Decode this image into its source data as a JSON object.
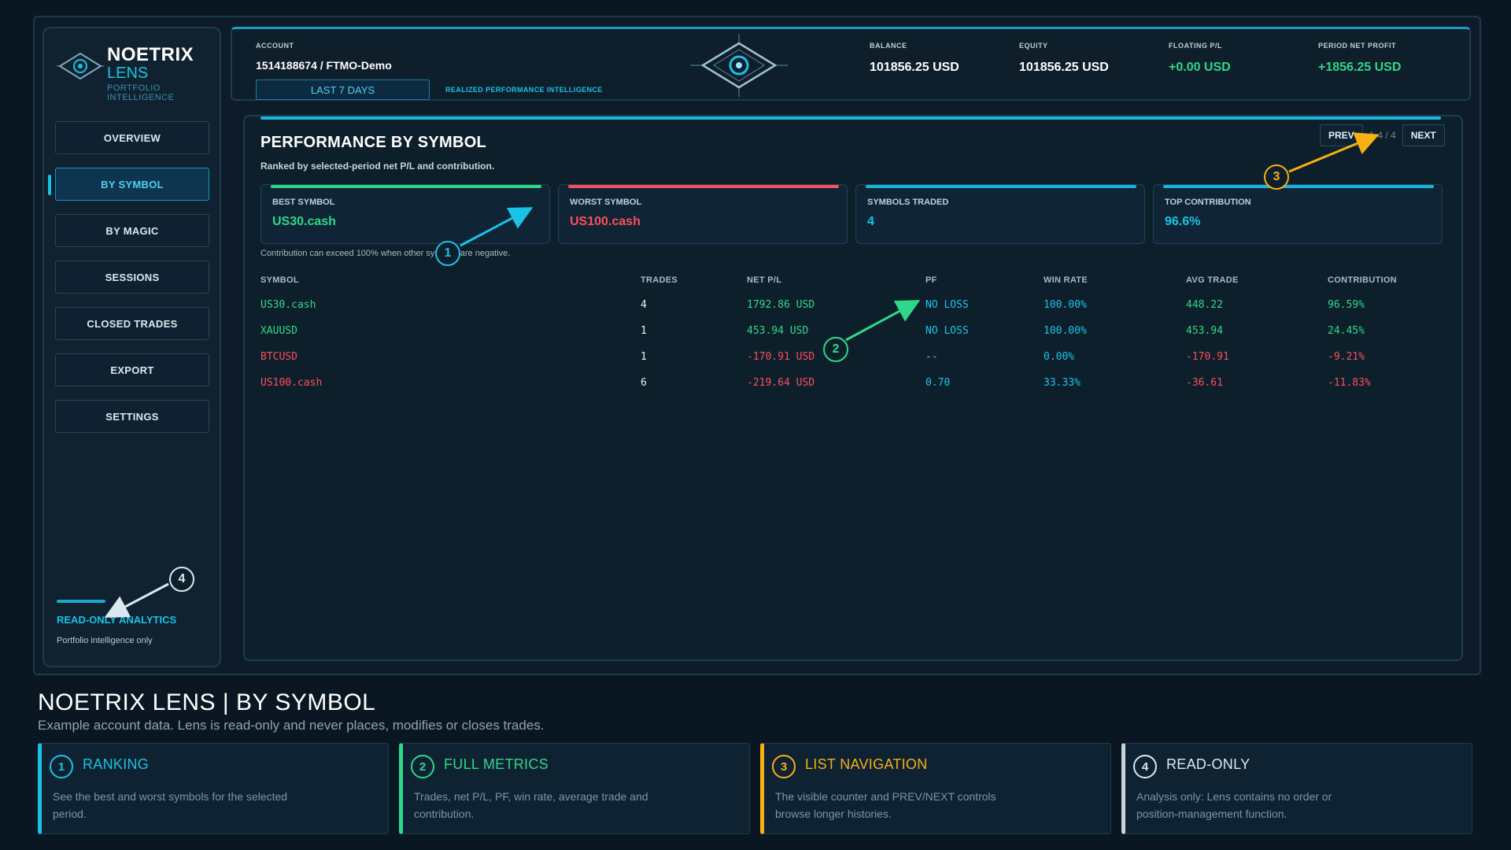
{
  "app": {
    "title": "NOETRIX",
    "subtitle": "LENS",
    "tagline": "PORTFOLIO INTELLIGENCE"
  },
  "nav": {
    "items": [
      "OVERVIEW",
      "BY SYMBOL",
      "BY MAGIC",
      "SESSIONS",
      "CLOSED TRADES",
      "EXPORT",
      "SETTINGS"
    ],
    "active": "BY SYMBOL"
  },
  "sidebar_footer": {
    "title": "READ-ONLY ANALYTICS",
    "subtitle": "Portfolio intelligence only"
  },
  "topbar": {
    "account_label": "ACCOUNT",
    "account_value": "1514188674 / FTMO-Demo",
    "period_button": "LAST 7 DAYS",
    "realized_tag": "REALIZED PERFORMANCE INTELLIGENCE",
    "balance_label": "BALANCE",
    "balance_value": "101856.25 USD",
    "equity_label": "EQUITY",
    "equity_value": "101856.25 USD",
    "floating_label": "FLOATING P/L",
    "floating_value": "+0.00 USD",
    "period_label": "PERIOD NET PROFIT",
    "period_value": "+1856.25 USD"
  },
  "main": {
    "title": "PERFORMANCE BY SYMBOL",
    "subtitle": "Ranked by selected-period net P/L and contribution.",
    "pager": {
      "prev": "PREV",
      "count": "1-4 / 4",
      "next": "NEXT"
    },
    "cards": [
      {
        "label": "BEST SYMBOL",
        "value": "US30.cash",
        "color": "#2ed888"
      },
      {
        "label": "WORST SYMBOL",
        "value": "US100.cash",
        "color": "#ff4d5a"
      },
      {
        "label": "SYMBOLS TRADED",
        "value": "4",
        "color": "#19c3e6"
      },
      {
        "label": "TOP CONTRIBUTION",
        "value": "96.6%",
        "color": "#19c3e6"
      }
    ],
    "note": "Contribution can exceed 100% when other symbols are negative.",
    "table": {
      "headers": [
        "SYMBOL",
        "TRADES",
        "NET P/L",
        "PF",
        "WIN RATE",
        "AVG TRADE",
        "CONTRIBUTION"
      ],
      "rows": [
        {
          "symbol": "US30.cash",
          "trades": "4",
          "net": "1792.86 USD",
          "pf": "NO LOSS",
          "win": "100.00%",
          "avg": "448.22",
          "contrib": "96.59%",
          "positive": true
        },
        {
          "symbol": "XAUUSD",
          "trades": "1",
          "net": "453.94 USD",
          "pf": "NO LOSS",
          "win": "100.00%",
          "avg": "453.94",
          "contrib": "24.45%",
          "positive": true
        },
        {
          "symbol": "BTCUSD",
          "trades": "1",
          "net": "-170.91 USD",
          "pf": "--",
          "win": "0.00%",
          "avg": "-170.91",
          "contrib": "-9.21%",
          "positive": false
        },
        {
          "symbol": "US100.cash",
          "trades": "6",
          "net": "-219.64 USD",
          "pf": "0.70",
          "win": "33.33%",
          "avg": "-36.61",
          "contrib": "-11.83%",
          "positive": false
        }
      ]
    }
  },
  "markers": [
    "1",
    "2",
    "3",
    "4"
  ],
  "caption": {
    "title": "NOETRIX LENS | BY SYMBOL",
    "subtitle": "Example account data. Lens is read-only and never places, modifies or closes trades.",
    "features": [
      {
        "num": "1",
        "title": "RANKING",
        "desc": "See the best and worst symbols for the selected period.",
        "color": "#19c3e6"
      },
      {
        "num": "2",
        "title": "FULL METRICS",
        "desc": "Trades, net P/L, PF, win rate, average trade and contribution.",
        "color": "#2ed888"
      },
      {
        "num": "3",
        "title": "LIST NAVIGATION",
        "desc": "The visible counter and PREV/NEXT controls browse longer histories.",
        "color": "#f5b014"
      },
      {
        "num": "4",
        "title": "READ-ONLY",
        "desc": "Analysis only: Lens contains no order or position-management function.",
        "color": "#dce8f0"
      }
    ]
  }
}
